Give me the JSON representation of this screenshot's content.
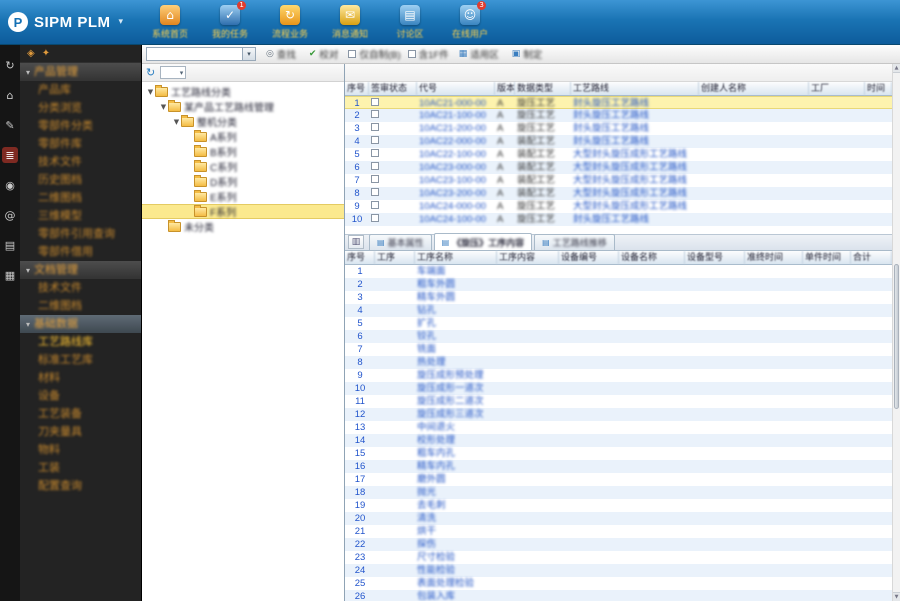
{
  "header": {
    "logo": "SIPM PLM",
    "caret": "▾",
    "nav": [
      {
        "label": "系统首页",
        "icon": "home",
        "badge": ""
      },
      {
        "label": "我的任务",
        "icon": "tasks",
        "badge": "1"
      },
      {
        "label": "流程业务",
        "icon": "flow",
        "badge": ""
      },
      {
        "label": "消息通知",
        "icon": "mail",
        "badge": ""
      },
      {
        "label": "讨论区",
        "icon": "board",
        "badge": ""
      },
      {
        "label": "在线用户",
        "icon": "users",
        "badge": "3"
      }
    ]
  },
  "icon_strip": [
    {
      "name": "sync-icon",
      "glyph": "↻",
      "active": false
    },
    {
      "name": "home-icon",
      "glyph": "⌂",
      "active": false
    },
    {
      "name": "edit-icon",
      "glyph": "✎",
      "active": false
    },
    {
      "name": "database-icon",
      "glyph": "≣",
      "active": true
    },
    {
      "name": "globe-icon",
      "glyph": "◉",
      "active": false
    },
    {
      "name": "mention-icon",
      "glyph": "@",
      "active": false
    },
    {
      "name": "library-icon",
      "glyph": "▤",
      "active": false
    },
    {
      "name": "apps-icon",
      "glyph": "▦",
      "active": false
    }
  ],
  "sidebar": {
    "mini_icons": [
      {
        "name": "sidebar-search-icon",
        "glyph": "◈"
      },
      {
        "name": "sidebar-pin-icon",
        "glyph": "✦"
      }
    ],
    "items": [
      {
        "type": "section",
        "label": "产品管理",
        "highlight": false,
        "selected": false
      },
      {
        "type": "item",
        "label": "产品库",
        "highlight": false,
        "selected": false
      },
      {
        "type": "item",
        "label": "分类浏览",
        "highlight": false,
        "selected": false
      },
      {
        "type": "item",
        "label": "零部件分类",
        "highlight": false,
        "selected": false
      },
      {
        "type": "item",
        "label": "零部件库",
        "highlight": false,
        "selected": false
      },
      {
        "type": "item",
        "label": "技术文件",
        "highlight": false,
        "selected": false
      },
      {
        "type": "item",
        "label": "历史图档",
        "highlight": false,
        "selected": false
      },
      {
        "type": "item",
        "label": "二维图档",
        "highlight": false,
        "selected": false
      },
      {
        "type": "item",
        "label": "三维模型",
        "highlight": false,
        "selected": false
      },
      {
        "type": "item",
        "label": "零部件引用查询",
        "highlight": false,
        "selected": false
      },
      {
        "type": "item",
        "label": "零部件借用",
        "highlight": false,
        "selected": false
      },
      {
        "type": "section",
        "label": "文档管理",
        "highlight": false,
        "selected": false
      },
      {
        "type": "item",
        "label": "技术文件",
        "highlight": false,
        "selected": false
      },
      {
        "type": "item",
        "label": "二维图档",
        "highlight": false,
        "selected": false
      },
      {
        "type": "section",
        "label": "基础数据",
        "highlight": true,
        "selected": false
      },
      {
        "type": "item",
        "label": "工艺路线库",
        "highlight": false,
        "selected": true
      },
      {
        "type": "item",
        "label": "标准工艺库",
        "highlight": false,
        "selected": false
      },
      {
        "type": "item",
        "label": "材料",
        "highlight": false,
        "selected": false
      },
      {
        "type": "item",
        "label": "设备",
        "highlight": false,
        "selected": false
      },
      {
        "type": "item",
        "label": "工艺装备",
        "highlight": false,
        "selected": false
      },
      {
        "type": "item",
        "label": "刀夹量具",
        "highlight": false,
        "selected": false
      },
      {
        "type": "item",
        "label": "物料",
        "highlight": false,
        "selected": false
      },
      {
        "type": "item",
        "label": "工装",
        "highlight": false,
        "selected": false
      },
      {
        "type": "item",
        "label": "配置查询",
        "highlight": false,
        "selected": false
      }
    ]
  },
  "toolbar": {
    "combo_value": "",
    "combo_caret": "▾",
    "buttons": [
      {
        "label": "查找",
        "glyph": "◎",
        "color": "#6a7682"
      },
      {
        "label": "校对",
        "glyph": "✔",
        "color": "#3a9a3a"
      },
      {
        "label": "适用区",
        "glyph": "▦",
        "color": "#3a7ec0"
      },
      {
        "label": "制定",
        "glyph": "▣",
        "color": "#3a7ec0"
      }
    ],
    "checkboxes": [
      {
        "label": "仅自制(B)",
        "checked": false
      },
      {
        "label": "含1F件",
        "checked": false
      }
    ]
  },
  "tree": {
    "toolbar": {
      "refresh_glyph": "↻",
      "dropdown_caret": "▾"
    },
    "nodes": [
      {
        "label": "工艺路线分类",
        "level": 0,
        "expanded": true,
        "selected": false
      },
      {
        "label": "某产品工艺路线管理",
        "level": 1,
        "expanded": true,
        "selected": false
      },
      {
        "label": "整机分类",
        "level": 2,
        "expanded": true,
        "selected": false
      },
      {
        "label": "A系列",
        "level": 3,
        "expanded": false,
        "selected": false
      },
      {
        "label": "B系列",
        "level": 3,
        "expanded": false,
        "selected": false
      },
      {
        "label": "C系列",
        "level": 3,
        "expanded": false,
        "selected": false
      },
      {
        "label": "D系列",
        "level": 3,
        "expanded": false,
        "selected": false
      },
      {
        "label": "E系列",
        "level": 3,
        "expanded": false,
        "selected": false
      },
      {
        "label": "F系列",
        "level": 3,
        "expanded": false,
        "selected": true
      },
      {
        "label": "未分类",
        "level": 1,
        "expanded": false,
        "selected": false
      }
    ]
  },
  "routes_table": {
    "columns": [
      "序号",
      "签审状态",
      "代号",
      "版本",
      "数据类型",
      "工艺路线",
      "创建人名称",
      "工厂",
      "时间"
    ],
    "rows": [
      {
        "num": "1",
        "code": "10AC21-000-00",
        "version": "A",
        "type": "旋压工艺",
        "route": "封头旋压工艺路线",
        "selected": true
      },
      {
        "num": "2",
        "code": "10AC21-100-00",
        "version": "A",
        "type": "旋压工艺",
        "route": "封头旋压工艺路线",
        "selected": false
      },
      {
        "num": "3",
        "code": "10AC21-200-00",
        "version": "A",
        "type": "旋压工艺",
        "route": "封头旋压工艺路线",
        "selected": false
      },
      {
        "num": "4",
        "code": "10AC22-000-00",
        "version": "A",
        "type": "装配工艺",
        "route": "封头旋压工艺路线",
        "selected": false
      },
      {
        "num": "5",
        "code": "10AC22-100-00",
        "version": "A",
        "type": "装配工艺",
        "route": "大型封头旋压成形工艺路线",
        "selected": false
      },
      {
        "num": "6",
        "code": "10AC23-000-00",
        "version": "A",
        "type": "装配工艺",
        "route": "大型封头旋压成形工艺路线",
        "selected": false
      },
      {
        "num": "7",
        "code": "10AC23-100-00",
        "version": "A",
        "type": "装配工艺",
        "route": "大型封头旋压成形工艺路线",
        "selected": false
      },
      {
        "num": "8",
        "code": "10AC23-200-00",
        "version": "A",
        "type": "装配工艺",
        "route": "大型封头旋压成形工艺路线",
        "selected": false
      },
      {
        "num": "9",
        "code": "10AC24-000-00",
        "version": "A",
        "type": "旋压工艺",
        "route": "大型封头旋压成形工艺路线",
        "selected": false
      },
      {
        "num": "10",
        "code": "10AC24-100-00",
        "version": "A",
        "type": "旋压工艺",
        "route": "封头旋压工艺路线",
        "selected": false
      }
    ]
  },
  "tabs": {
    "left_glyph": "▥",
    "items": [
      {
        "label": "基本属性",
        "selected": false
      },
      {
        "label": "《旋压》工序内容",
        "selected": true
      },
      {
        "label": "工艺路线推移",
        "selected": false
      }
    ]
  },
  "ops_table": {
    "columns": [
      "序号",
      "工序",
      "工序名称",
      "工序内容",
      "设备编号",
      "设备名称",
      "设备型号",
      "准终时间",
      "单件时间",
      "合计"
    ],
    "rows": [
      {
        "num": "1",
        "name": "车端面"
      },
      {
        "num": "2",
        "name": "粗车外圆"
      },
      {
        "num": "3",
        "name": "精车外圆"
      },
      {
        "num": "4",
        "name": "钻孔"
      },
      {
        "num": "5",
        "name": "扩孔"
      },
      {
        "num": "6",
        "name": "铰孔"
      },
      {
        "num": "7",
        "name": "铣面"
      },
      {
        "num": "8",
        "name": "热处理"
      },
      {
        "num": "9",
        "name": "旋压成形预处理"
      },
      {
        "num": "10",
        "name": "旋压成形一道次"
      },
      {
        "num": "11",
        "name": "旋压成形二道次"
      },
      {
        "num": "12",
        "name": "旋压成形三道次"
      },
      {
        "num": "13",
        "name": "中间退火"
      },
      {
        "num": "14",
        "name": "校形处理"
      },
      {
        "num": "15",
        "name": "粗车内孔"
      },
      {
        "num": "16",
        "name": "精车内孔"
      },
      {
        "num": "17",
        "name": "磨外圆"
      },
      {
        "num": "18",
        "name": "抛光"
      },
      {
        "num": "19",
        "name": "去毛刺"
      },
      {
        "num": "20",
        "name": "清洗"
      },
      {
        "num": "21",
        "name": "烘干"
      },
      {
        "num": "22",
        "name": "探伤"
      },
      {
        "num": "23",
        "name": "尺寸检验"
      },
      {
        "num": "24",
        "name": "性能检验"
      },
      {
        "num": "25",
        "name": "表面处理检验"
      },
      {
        "num": "26",
        "name": "包装入库"
      }
    ]
  },
  "colors": {
    "header_blue": "#1a74b4",
    "accent_orange": "#e8a33d",
    "selected_row_yellow": "#fdf3ae",
    "link_blue": "#2053c5",
    "badge_red": "#e03c2e"
  }
}
